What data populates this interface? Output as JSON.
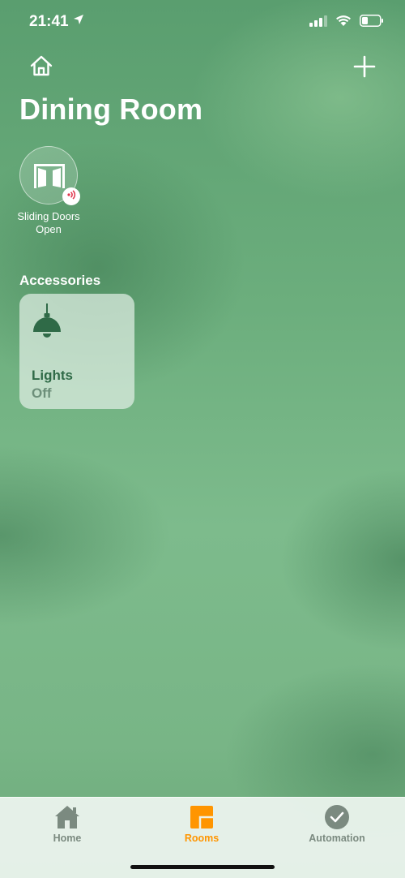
{
  "status_bar": {
    "time": "21:41",
    "icons": [
      "location-arrow-icon",
      "cellular-signal-icon",
      "wifi-icon",
      "battery-icon"
    ]
  },
  "header": {
    "home_icon": "house-icon",
    "add_icon": "plus-icon",
    "title": "Dining Room"
  },
  "scene": {
    "icon": "sliding-doors-icon",
    "badge_icon": "vibration-alert-icon",
    "name": "Sliding Doors",
    "state": "Open"
  },
  "accessories": {
    "heading": "Accessories",
    "items": [
      {
        "icon": "pendant-lamp-icon",
        "name": "Lights",
        "state": "Off"
      }
    ]
  },
  "tab_bar": {
    "tabs": [
      {
        "label": "Home",
        "icon": "house-icon",
        "active": false
      },
      {
        "label": "Rooms",
        "icon": "rooms-icon",
        "active": true
      },
      {
        "label": "Automation",
        "icon": "clock-check-icon",
        "active": false
      }
    ]
  },
  "colors": {
    "active_tab": "#ff9500",
    "inactive_tab": "#7b8a80",
    "tile_name": "#2f6a47",
    "tile_state": "#6d8f7a",
    "badge_alert": "#e0334a"
  }
}
